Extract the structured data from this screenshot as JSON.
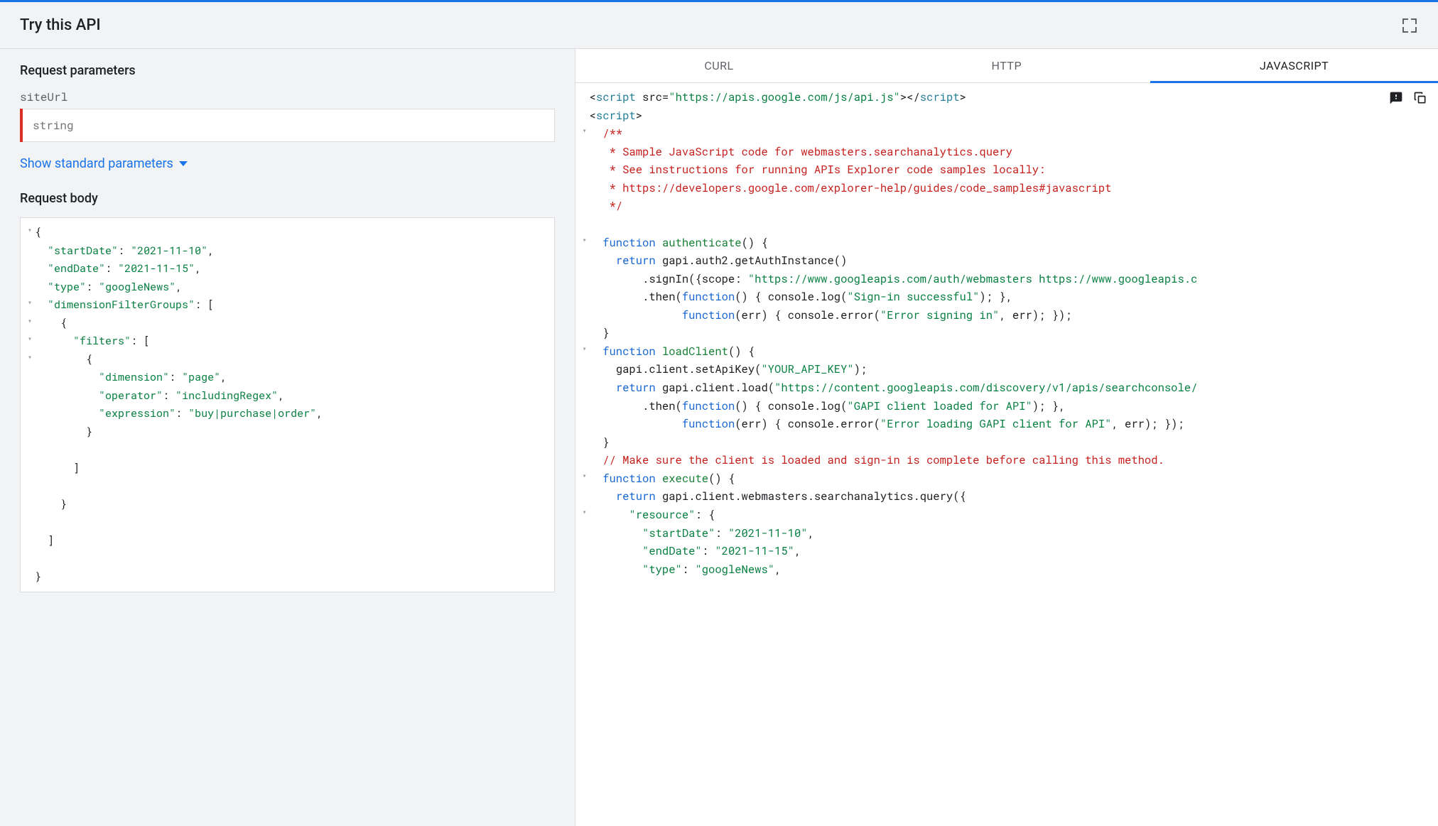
{
  "header": {
    "title": "Try this API"
  },
  "left": {
    "params_title": "Request parameters",
    "param_name": "siteUrl",
    "param_placeholder": "string",
    "expand_link": "Show standard parameters",
    "body_title": "Request body",
    "json": {
      "startDate": "2021-11-10",
      "endDate": "2021-11-15",
      "type": "googleNews",
      "filter_dimension": "page",
      "filter_operator": "includingRegex",
      "filter_expression": "buy|purchase|order"
    }
  },
  "tabs": {
    "curl": "cURL",
    "http": "HTTP",
    "javascript": "JAVASCRIPT"
  },
  "code": {
    "script_src": "https://apis.google.com/js/api.js",
    "comment_l1": "/**",
    "comment_l2": " * Sample JavaScript code for webmasters.searchanalytics.query",
    "comment_l3": " * See instructions for running APIs Explorer code samples locally:",
    "comment_l4": " * https://developers.google.com/explorer-help/guides/code_samples#javascript",
    "comment_l5": " */",
    "fn_auth": "authenticate",
    "ret": "return",
    "auth_chain": "gapi.auth2.getAuthInstance()",
    "scope_str": "\"https://www.googleapis.com/auth/webmasters https://www.googleapis.c",
    "signin_log": "\"Sign-in successful\"",
    "signin_err": "\"Error signing in\"",
    "fn_load": "loadClient",
    "api_key": "\"YOUR_API_KEY\"",
    "load_url": "\"https://content.googleapis.com/discovery/v1/apis/searchconsole/",
    "load_log": "\"GAPI client loaded for API\"",
    "load_err": "\"Error loading GAPI client for API\"",
    "comment_exec": "// Make sure the client is loaded and sign-in is complete before calling this method.",
    "fn_exec": "execute",
    "exec_chain": "gapi.client.webmasters.searchanalytics.query({",
    "res_key": "\"resource\"",
    "res_startdate_k": "\"startDate\"",
    "res_startdate_v": "\"2021-11-10\"",
    "res_enddate_k": "\"endDate\"",
    "res_enddate_v": "\"2021-11-15\"",
    "res_type_k": "\"type\"",
    "res_type_v": "\"googleNews\""
  }
}
